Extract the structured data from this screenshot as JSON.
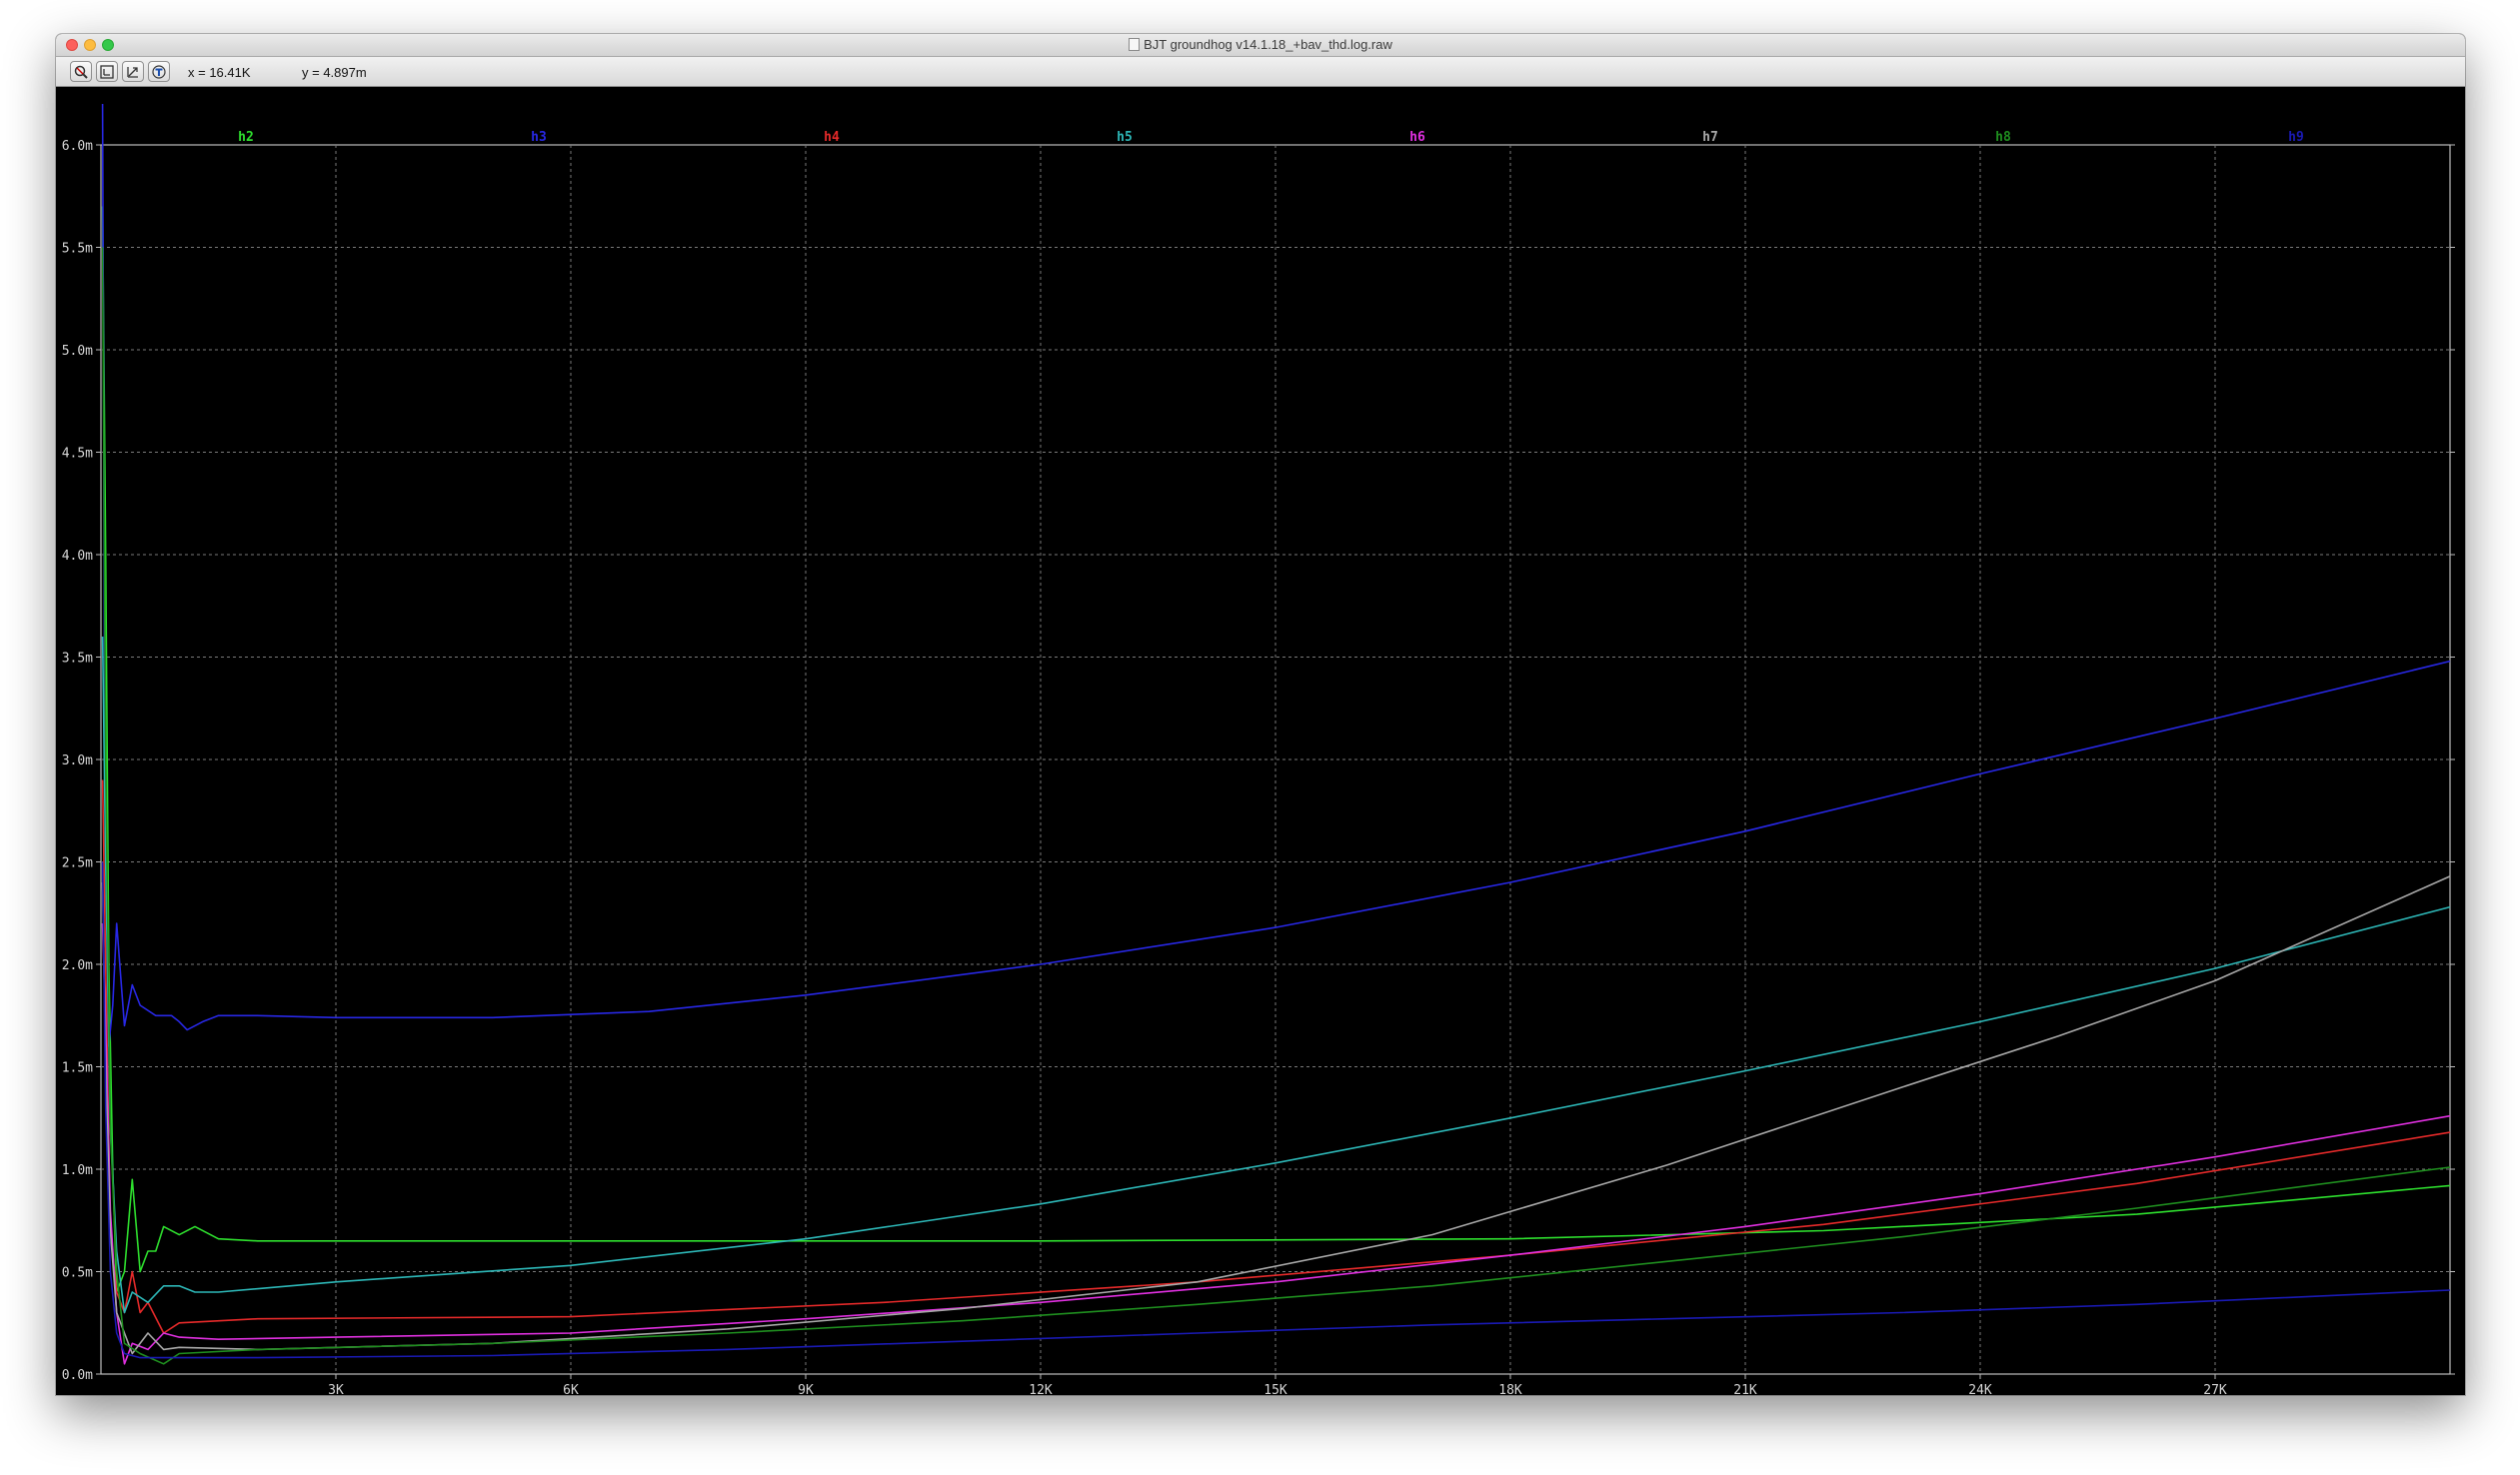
{
  "window": {
    "title": "BJT groundhog v14.1.18_+bav_thd.log.raw"
  },
  "toolbar": {
    "buttons": [
      {
        "name": "zoom-area-button",
        "icon": "magnifier-icon"
      },
      {
        "name": "zoom-fit-button",
        "icon": "zoom-fit-icon"
      },
      {
        "name": "zoom-out-button",
        "icon": "zoom-out-icon"
      },
      {
        "name": "autorange-button",
        "icon": "pan-icon"
      }
    ],
    "cursor_x": "x = 16.41K",
    "cursor_y": "y = 4.897m"
  },
  "chart_data": {
    "type": "line",
    "title": "",
    "xlabel": "",
    "ylabel": "",
    "xlim": [
      0,
      30000
    ],
    "ylim": [
      0,
      0.006
    ],
    "grid": true,
    "legend_placement": "top",
    "x_ticks": [
      {
        "value": 3000,
        "label": "3K"
      },
      {
        "value": 6000,
        "label": "6K"
      },
      {
        "value": 9000,
        "label": "9K"
      },
      {
        "value": 12000,
        "label": "12K"
      },
      {
        "value": 15000,
        "label": "15K"
      },
      {
        "value": 18000,
        "label": "18K"
      },
      {
        "value": 21000,
        "label": "21K"
      },
      {
        "value": 24000,
        "label": "24K"
      },
      {
        "value": 27000,
        "label": "27K"
      }
    ],
    "y_ticks": [
      {
        "value": 0.0,
        "label": "0.0m"
      },
      {
        "value": 0.0005,
        "label": "0.5m"
      },
      {
        "value": 0.001,
        "label": "1.0m"
      },
      {
        "value": 0.0015,
        "label": "1.5m"
      },
      {
        "value": 0.002,
        "label": "2.0m"
      },
      {
        "value": 0.0025,
        "label": "2.5m"
      },
      {
        "value": 0.003,
        "label": "3.0m"
      },
      {
        "value": 0.0035,
        "label": "3.5m"
      },
      {
        "value": 0.004,
        "label": "4.0m"
      },
      {
        "value": 0.0045,
        "label": "4.5m"
      },
      {
        "value": 0.005,
        "label": "5.0m"
      },
      {
        "value": 0.0055,
        "label": "5.5m"
      },
      {
        "value": 0.006,
        "label": "6.0m"
      }
    ],
    "series": [
      {
        "name": "h2",
        "color": "#2ee02e",
        "points": [
          [
            20,
            0.0057
          ],
          [
            60,
            0.004
          ],
          [
            100,
            0.002
          ],
          [
            150,
            0.001
          ],
          [
            200,
            0.0004
          ],
          [
            300,
            0.0005
          ],
          [
            400,
            0.00095
          ],
          [
            500,
            0.0005
          ],
          [
            600,
            0.0006
          ],
          [
            700,
            0.0006
          ],
          [
            800,
            0.00072
          ],
          [
            1000,
            0.00068
          ],
          [
            1200,
            0.00072
          ],
          [
            1500,
            0.00066
          ],
          [
            2000,
            0.00065
          ],
          [
            4000,
            0.00065
          ],
          [
            8000,
            0.00065
          ],
          [
            12000,
            0.00065
          ],
          [
            18000,
            0.00066
          ],
          [
            22000,
            0.0007
          ],
          [
            26000,
            0.00078
          ],
          [
            30000,
            0.00092
          ]
        ]
      },
      {
        "name": "h3",
        "color": "#2828e6",
        "points": [
          [
            20,
            0.0062
          ],
          [
            50,
            0.003
          ],
          [
            100,
            0.0016
          ],
          [
            150,
            0.0018
          ],
          [
            200,
            0.0022
          ],
          [
            300,
            0.0017
          ],
          [
            400,
            0.0019
          ],
          [
            500,
            0.0018
          ],
          [
            700,
            0.00175
          ],
          [
            900,
            0.00175
          ],
          [
            1000,
            0.00172
          ],
          [
            1100,
            0.00168
          ],
          [
            1300,
            0.00172
          ],
          [
            1500,
            0.00175
          ],
          [
            2000,
            0.00175
          ],
          [
            3000,
            0.00174
          ],
          [
            5000,
            0.00174
          ],
          [
            7000,
            0.00177
          ],
          [
            9000,
            0.00185
          ],
          [
            12000,
            0.002
          ],
          [
            15000,
            0.00218
          ],
          [
            18000,
            0.0024
          ],
          [
            21000,
            0.00265
          ],
          [
            24000,
            0.00293
          ],
          [
            27000,
            0.0032
          ],
          [
            30000,
            0.00348
          ]
        ]
      },
      {
        "name": "h4",
        "color": "#e62a2a",
        "points": [
          [
            20,
            0.0029
          ],
          [
            60,
            0.002
          ],
          [
            120,
            0.0007
          ],
          [
            200,
            0.0004
          ],
          [
            300,
            0.0003
          ],
          [
            400,
            0.0005
          ],
          [
            500,
            0.0003
          ],
          [
            600,
            0.00035
          ],
          [
            800,
            0.0002
          ],
          [
            1000,
            0.00025
          ],
          [
            2000,
            0.00027
          ],
          [
            6000,
            0.00028
          ],
          [
            10000,
            0.00035
          ],
          [
            14000,
            0.00045
          ],
          [
            18000,
            0.00058
          ],
          [
            22000,
            0.00073
          ],
          [
            26000,
            0.00093
          ],
          [
            30000,
            0.00118
          ]
        ]
      },
      {
        "name": "h5",
        "color": "#2db7b7",
        "points": [
          [
            20,
            0.0036
          ],
          [
            60,
            0.0025
          ],
          [
            120,
            0.0012
          ],
          [
            200,
            0.0006
          ],
          [
            300,
            0.0003
          ],
          [
            400,
            0.0004
          ],
          [
            600,
            0.00035
          ],
          [
            800,
            0.00043
          ],
          [
            1000,
            0.00043
          ],
          [
            1200,
            0.0004
          ],
          [
            1500,
            0.0004
          ],
          [
            3000,
            0.00045
          ],
          [
            6000,
            0.00053
          ],
          [
            9000,
            0.00066
          ],
          [
            12000,
            0.00083
          ],
          [
            15000,
            0.00103
          ],
          [
            18000,
            0.00125
          ],
          [
            21000,
            0.00148
          ],
          [
            24000,
            0.00172
          ],
          [
            27000,
            0.00198
          ],
          [
            30000,
            0.00228
          ]
        ]
      },
      {
        "name": "h6",
        "color": "#e030e0",
        "points": [
          [
            20,
            0.0022
          ],
          [
            60,
            0.0017
          ],
          [
            120,
            0.0008
          ],
          [
            200,
            0.0003
          ],
          [
            300,
            5e-05
          ],
          [
            400,
            0.00015
          ],
          [
            600,
            0.00012
          ],
          [
            800,
            0.0002
          ],
          [
            1000,
            0.00018
          ],
          [
            1500,
            0.00017
          ],
          [
            3000,
            0.00018
          ],
          [
            6000,
            0.0002
          ],
          [
            9000,
            0.00027
          ],
          [
            12000,
            0.00035
          ],
          [
            15000,
            0.00045
          ],
          [
            18000,
            0.00058
          ],
          [
            21000,
            0.00072
          ],
          [
            24000,
            0.00088
          ],
          [
            27000,
            0.00106
          ],
          [
            30000,
            0.00126
          ]
        ]
      },
      {
        "name": "h7",
        "color": "#a8a8a8",
        "points": [
          [
            20,
            0.0024
          ],
          [
            60,
            0.0015
          ],
          [
            120,
            0.0007
          ],
          [
            200,
            0.0003
          ],
          [
            400,
            0.0001
          ],
          [
            600,
            0.0002
          ],
          [
            800,
            0.00012
          ],
          [
            1000,
            0.00013
          ],
          [
            2000,
            0.00012
          ],
          [
            5000,
            0.00015
          ],
          [
            8000,
            0.00022
          ],
          [
            11000,
            0.00032
          ],
          [
            14000,
            0.00045
          ],
          [
            17000,
            0.00068
          ],
          [
            20000,
            0.00102
          ],
          [
            23000,
            0.0014
          ],
          [
            25000,
            0.00165
          ],
          [
            27000,
            0.00192
          ],
          [
            30000,
            0.00243
          ]
        ]
      },
      {
        "name": "h8",
        "color": "#1f8f1f",
        "points": [
          [
            20,
            0.0055
          ],
          [
            60,
            0.003
          ],
          [
            120,
            0.0012
          ],
          [
            200,
            0.0005
          ],
          [
            300,
            0.00015
          ],
          [
            500,
            0.0001
          ],
          [
            800,
            5e-05
          ],
          [
            1000,
            0.0001
          ],
          [
            2000,
            0.00012
          ],
          [
            5000,
            0.00015
          ],
          [
            8000,
            0.0002
          ],
          [
            11000,
            0.00026
          ],
          [
            14000,
            0.00034
          ],
          [
            17000,
            0.00043
          ],
          [
            20000,
            0.00055
          ],
          [
            23000,
            0.00067
          ],
          [
            26000,
            0.00081
          ],
          [
            30000,
            0.00101
          ]
        ]
      },
      {
        "name": "h9",
        "color": "#1a1ab4",
        "points": [
          [
            20,
            0.0025
          ],
          [
            60,
            0.0013
          ],
          [
            120,
            0.0005
          ],
          [
            200,
            0.0002
          ],
          [
            300,
            0.0001
          ],
          [
            500,
            8e-05
          ],
          [
            1000,
            8e-05
          ],
          [
            2000,
            8e-05
          ],
          [
            5000,
            9e-05
          ],
          [
            8000,
            0.00012
          ],
          [
            11000,
            0.00016
          ],
          [
            14000,
            0.0002
          ],
          [
            17000,
            0.00024
          ],
          [
            20000,
            0.00027
          ],
          [
            23000,
            0.0003
          ],
          [
            26000,
            0.00034
          ],
          [
            30000,
            0.00041
          ]
        ]
      }
    ]
  }
}
